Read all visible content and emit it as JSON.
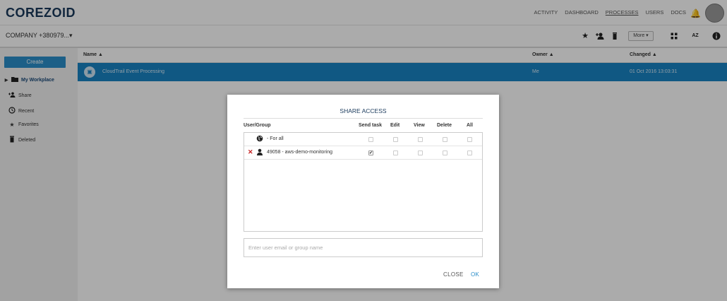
{
  "app": {
    "logo": "COREZOID"
  },
  "nav": {
    "items": [
      "ACTIVITY",
      "DASHBOARD",
      "PROCESSES",
      "USERS",
      "DOCS"
    ],
    "active": "PROCESSES"
  },
  "toolbar": {
    "company": "COMPANY +380979...▾",
    "more_label": "More ▾"
  },
  "icons": {
    "bell": "alarm-bell-icon",
    "favorite": "star-icon",
    "share": "add-user-icon",
    "delete": "trash-icon",
    "grid": "grid-view-icon",
    "sort": "sort-az-icon",
    "info": "info-icon"
  },
  "sidebar": {
    "create_label": "Create",
    "items": [
      {
        "label": "My Workplace",
        "icon": "folder-icon"
      },
      {
        "label": "Share",
        "icon": "share-users-icon"
      },
      {
        "label": "Recent",
        "icon": "clock-icon"
      },
      {
        "label": "Favorites",
        "icon": "star-icon"
      },
      {
        "label": "Deleted",
        "icon": "trash-icon"
      }
    ]
  },
  "list": {
    "columns": {
      "name": "Name ▲",
      "owner": "Owner ▲",
      "changed": "Changed ▲"
    },
    "rows": [
      {
        "name": "CloudTrail Event Processing",
        "owner": "Me",
        "changed": "01 Oct 2016 13:03:31"
      }
    ]
  },
  "modal": {
    "title": "SHARE ACCESS",
    "columns": [
      "User/Group",
      "Send task",
      "Edit",
      "View",
      "Delete",
      "All"
    ],
    "rows": [
      {
        "label": "- For all",
        "icon": "globe-icon",
        "removable": false,
        "checks": [
          false,
          false,
          false,
          false,
          false
        ]
      },
      {
        "label": "49058 - aws-demo-monitoring",
        "icon": "user-icon",
        "removable": true,
        "checks": [
          true,
          false,
          false,
          false,
          false
        ]
      }
    ],
    "input_placeholder": "Enter user email or group name",
    "close_label": "CLOSE",
    "ok_label": "OK"
  },
  "colors": {
    "accent": "#2a8ec9",
    "selected_row": "#1883c4",
    "logo": "#1a3a5c",
    "remove": "#c62020"
  }
}
